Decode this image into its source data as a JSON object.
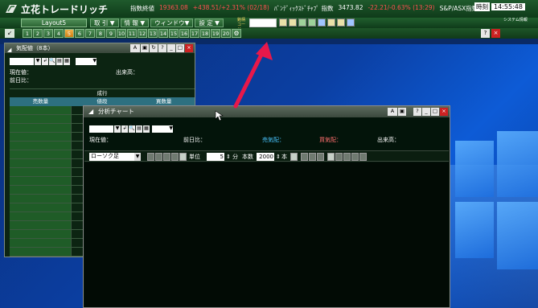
{
  "app": {
    "title": "立花トレードリッチ",
    "layout_tab": "Layout5"
  },
  "ticker": {
    "index_label": "指数終値",
    "index_value": "19363.08",
    "index_change": "+438.51/+2.31% (02/18)",
    "future_label": "ﾊﾞﾝﾃﾞｨｯｸｽﾄﾞﾁｬﾌﾟ 指数",
    "future_value": "3473.82",
    "future_change": "-22.21/-0.63% (13:29)",
    "sp_label": "S&P/ASX指数",
    "time_label": "時刻",
    "time_value": "14:55:48"
  },
  "menu": {
    "items": [
      "取 引 ▼",
      "情 報 ▼",
      "ウィンドウ▼",
      "設 定 ▼"
    ],
    "code_label": "銘柄コード",
    "system_label": "システム情報"
  },
  "numbar": {
    "back": "↙",
    "numbers": [
      "1",
      "2",
      "3",
      "4",
      "5",
      "6",
      "7",
      "8",
      "9",
      "10",
      "11",
      "12",
      "13",
      "14",
      "15",
      "16",
      "17",
      "18",
      "19",
      "20"
    ],
    "active": "5",
    "gear": "⚙",
    "help": "?",
    "close": "×"
  },
  "board": {
    "title": "気配値（8本）",
    "current_price": "現在値：",
    "volume": "出来高：",
    "prev_change": "前日比：",
    "market_order": "成行",
    "col_sell": "売数量",
    "col_price": "値段",
    "col_buy": "買数量",
    "btn_a": "A",
    "btn_help": "?",
    "btn_min": "_",
    "btn_max": "□",
    "btn_close": "×"
  },
  "chart": {
    "title": "分析チャート",
    "current_price": "現在値：",
    "prev_change": "前日比：",
    "sell_quote": "売気配：",
    "buy_quote": "買気配：",
    "volume": "出来高：",
    "candle_type": "ローソク足",
    "unit_label": "単位",
    "unit_value": "5",
    "unit_suffix": "分",
    "count_label": "本数",
    "count_value": "2000",
    "count_suffix": "本",
    "btn_a": "A",
    "btn_help": "?",
    "btn_min": "_",
    "btn_max": "□",
    "btn_close": "×"
  },
  "colors": {
    "arrow": "#e8184a",
    "sell_quote": "#49c4ff",
    "buy_quote": "#ff6f6f"
  }
}
